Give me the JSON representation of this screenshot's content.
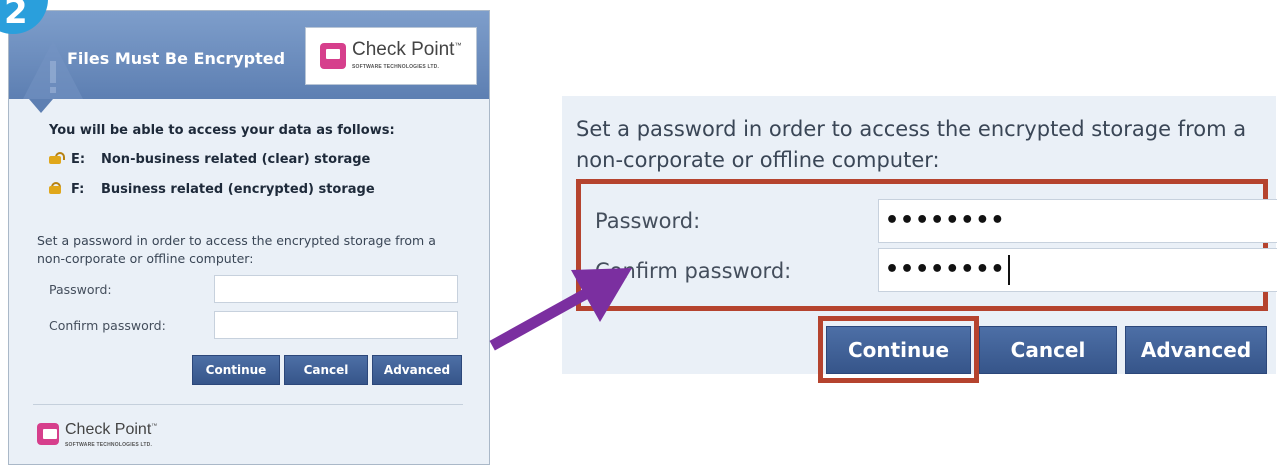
{
  "step_number": "2",
  "colors": {
    "badge": "#2a9fdc",
    "header": "#5d7fb2",
    "button": "#3f5f96",
    "highlight": "#b5432e",
    "arrow": "#7b2fa0",
    "logo_icon": "#d63f8c"
  },
  "dialog": {
    "title": "Files Must Be Encrypted",
    "logo": {
      "name": "Check Point",
      "tm": "™",
      "tagline": "SOFTWARE TECHNOLOGIES LTD."
    },
    "access_intro": "You will be able to access your data as follows:",
    "drives": [
      {
        "icon": "open-lock-icon",
        "letter": "E:",
        "label": "Non-business related (clear) storage"
      },
      {
        "icon": "lock-icon",
        "letter": "F:",
        "label": "Business related (encrypted) storage"
      }
    ],
    "password_description": "Set a password in order to access the encrypted storage from a non-corporate or offline computer:",
    "password_label": "Password:",
    "confirm_label": "Confirm password:",
    "password_value": "",
    "confirm_value": "",
    "buttons": {
      "continue": "Continue",
      "cancel": "Cancel",
      "advanced": "Advanced"
    },
    "footer_logo": {
      "name": "Check Point",
      "tm": "™",
      "tagline": "SOFTWARE TECHNOLOGIES LTD."
    }
  },
  "zoom": {
    "password_description": "Set a password in order to access the encrypted storage from a non-corporate or offline computer:",
    "password_label": "Password:",
    "confirm_label": "Confirm password:",
    "password_mask": "••••••••",
    "confirm_mask": "••••••••",
    "buttons": {
      "continue": "Continue",
      "cancel": "Cancel",
      "advanced": "Advanced"
    }
  }
}
